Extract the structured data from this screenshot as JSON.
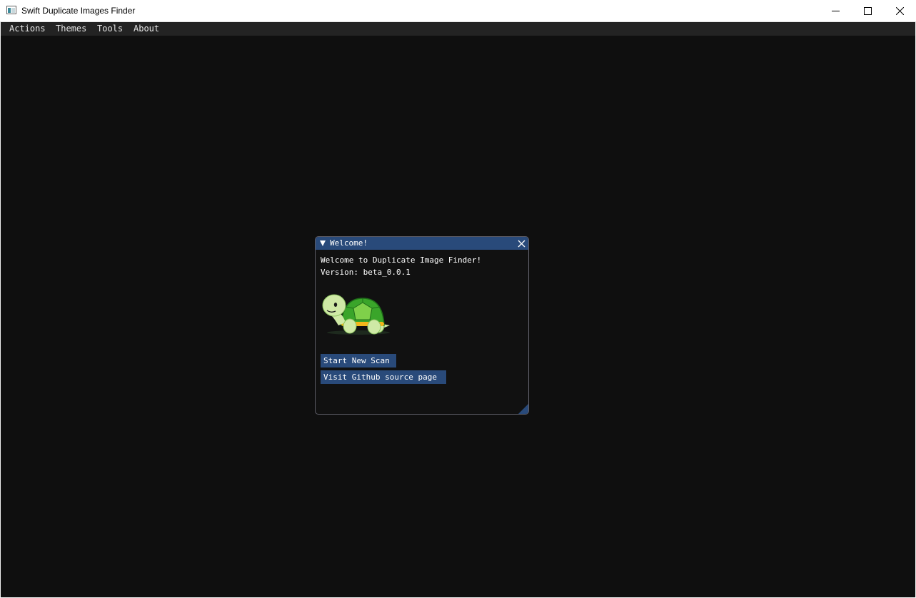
{
  "window": {
    "title": "Swift Duplicate Images Finder",
    "controls": [
      "minimize",
      "maximize",
      "close"
    ]
  },
  "menubar": {
    "items": [
      {
        "label": "Actions"
      },
      {
        "label": "Themes"
      },
      {
        "label": "Tools"
      },
      {
        "label": "About"
      }
    ]
  },
  "welcome": {
    "title": "Welcome!",
    "message": "Welcome to Duplicate Image Finder!",
    "version": "Version: beta_0.0.1",
    "buttons": {
      "start_scan": "Start New Scan",
      "github": "Visit Github source page"
    }
  },
  "colors": {
    "background": "#0f0f0f",
    "menubar": "#232323",
    "accent": "#294a7a",
    "text": "#ffffff"
  },
  "icons": [
    "app-icon",
    "minimize-icon",
    "maximize-icon",
    "close-icon",
    "collapse-arrow-icon",
    "turtle-logo",
    "resize-grip-icon"
  ]
}
